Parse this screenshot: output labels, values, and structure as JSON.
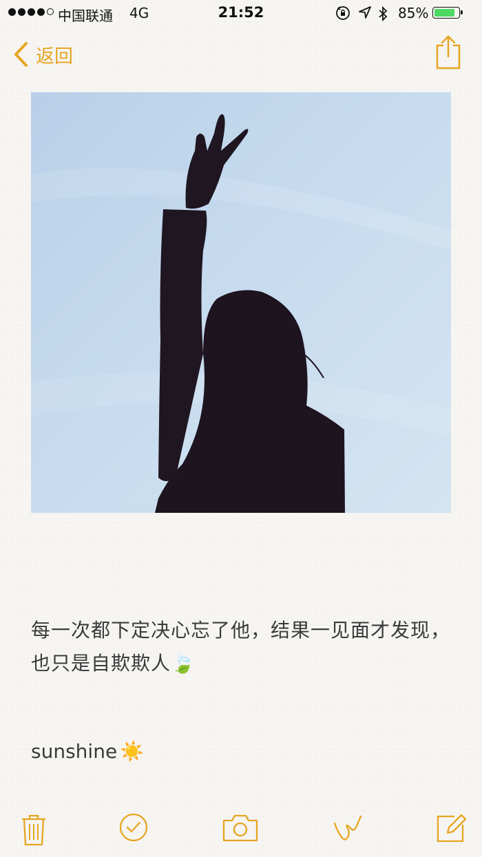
{
  "status_bar": {
    "carrier": "中国联通",
    "network": "4G",
    "time": "21:52",
    "battery_percent": "85%",
    "battery_level": 0.85,
    "signal_bars": 4
  },
  "nav": {
    "back_label": "返回",
    "share_icon": "share-icon"
  },
  "note": {
    "image_icon": "photo-silhouette-peace-sign",
    "body": "每一次都下定决心忘了他，结果一见面才发现，也只是自欺欺人",
    "body_emoji": "🍃",
    "sign": "sunshine",
    "sign_emoji": "☀️"
  },
  "toolbar": {
    "items": [
      "trash-icon",
      "checklist-icon",
      "camera-icon",
      "sketch-icon",
      "compose-icon"
    ]
  },
  "colors": {
    "accent": "#e6a521",
    "sky": "#c6dcf0",
    "silhouette": "#1d1420",
    "battery": "#4cd964"
  }
}
